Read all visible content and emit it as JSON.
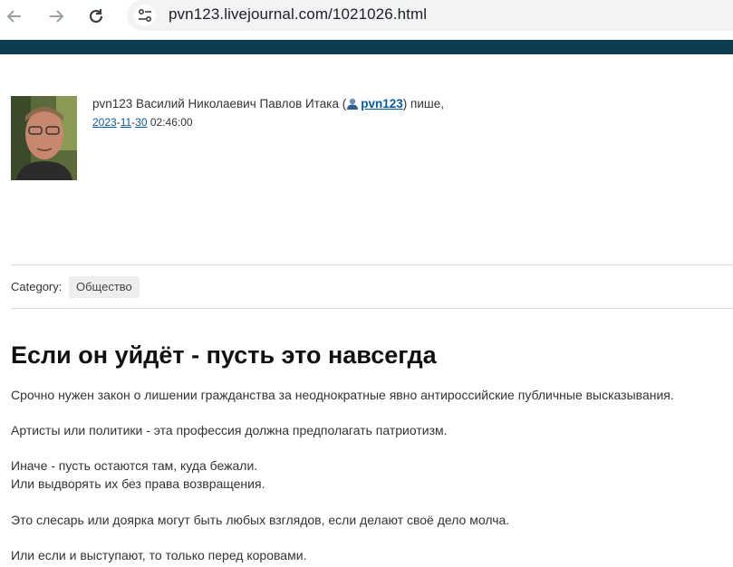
{
  "browser": {
    "url": "pvn123.livejournal.com/1021026.html",
    "back_icon": "arrow-left-icon",
    "forward_icon": "arrow-right-icon",
    "reload_icon": "reload-icon",
    "site_info_icon": "tune-icon"
  },
  "post": {
    "author_text": "pvn123 Василий Николаевич Павлов Итака (",
    "username": "pvn123",
    "author_suffix": ") пише,",
    "date": {
      "year": "2023",
      "sep1": "-",
      "month": "11",
      "sep2": "-",
      "day": "30",
      "time": " 02:46:00"
    },
    "category_label": "Category:",
    "category": "Общество",
    "title": "Если он уйдёт - пусть это навсегда",
    "paragraphs": [
      "Срочно нужен закон о лишении гражданства за неоднократные явно антироссийские публичные высказывания.",
      "Артисты или политики - эта профессия должна предполагать патриотизм.",
      "Иначе - пусть остаются там, куда бежали.",
      "Или выдворять их без права возвращения.",
      "Это слесарь или доярка могут быть любых взглядов, если делают своё дело молча.",
      "Или если и выступают, то только перед коровами."
    ]
  }
}
